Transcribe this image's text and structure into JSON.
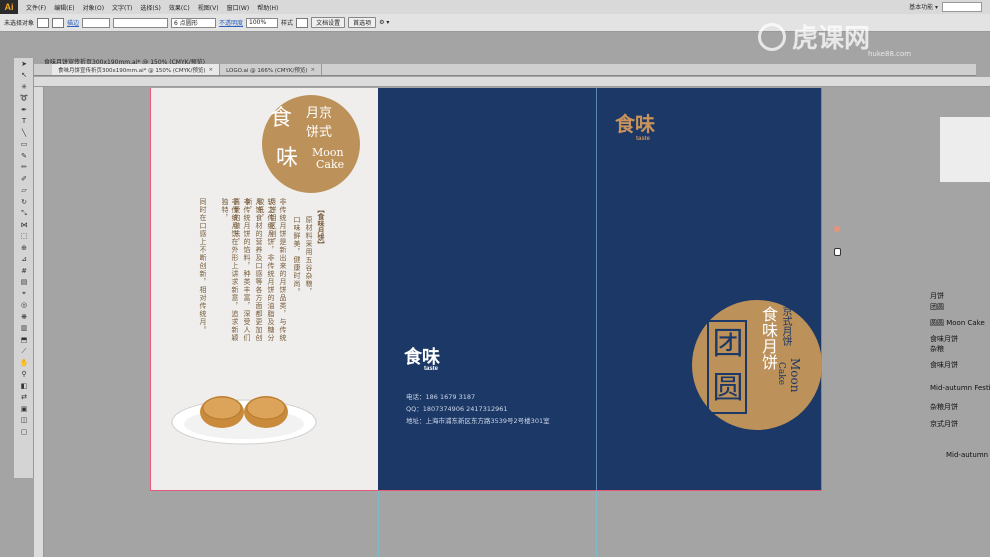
{
  "app": {
    "logo": "Ai",
    "menu": [
      "文件(F)",
      "编辑(E)",
      "对象(O)",
      "文字(T)",
      "选择(S)",
      "效果(C)",
      "视图(V)",
      "窗口(W)",
      "帮助(H)"
    ],
    "workspace": "基本功能 ▾"
  },
  "control_bar": {
    "selection": "未选择对象",
    "stroke_label": "描边",
    "stroke_width": "6 点圆形",
    "opacity_label": "不透明度",
    "opacity_value": "100%",
    "style_label": "样式",
    "doc_setup": "文档设置",
    "prefs": "首选项"
  },
  "document": {
    "title": "食味月饼宣传折页300x190mm.ai* @ 150% (CMYK/预览)",
    "tabs": [
      {
        "label": "食味月饼宣传折页300x190mm.ai* @ 150% (CMYK/预览)",
        "active": true
      },
      {
        "label": "LOGO.ai @ 166% (CMYK/预览)",
        "active": false
      }
    ]
  },
  "artwork": {
    "cover_circle": {
      "big1": "食",
      "big2": "味",
      "small1": "月京",
      "small2": "饼式",
      "en1": "Moon",
      "en2": "Cake"
    },
    "product_title": "【食味月饼】",
    "product_copy": [
      "原材料采用五谷杂粮，",
      "口味鲜美，健康时尚。",
      "非传统月饼是新出来的月饼品类，与传统月饼相区别，",
      "较之传统月饼，非传统月饼的油脂及糖分较低，",
      "月饼食材的营养及口感等各方面都更加创新，",
      "非传统月饼的馅料，种类丰富，深受人们喜爱的做法，",
      "非传统月饼在外形上讲求新意，追求新颖独特，",
      "同时在口感上不断创新，相对传统月。"
    ],
    "logo": {
      "cn": "食味",
      "en": "taste"
    },
    "contact": {
      "phone": "电话：186 1679 3187",
      "qq": "QQ：1807374906  2417312961",
      "address": "地址：上海市浦东新区东方路3539号2号楼301室"
    },
    "back_circle": {
      "tuan": "团",
      "yuan": "圆",
      "line1": "食味月饼",
      "line2": "京式月饼",
      "en1": "Moon",
      "en2": "Cake"
    }
  },
  "layers_panel": [
    "月饼",
    "团圆",
    "圆圆 Moon Cake",
    "食味月饼",
    "杂粮",
    "食味月饼",
    "Mid-autumn Festiv",
    "杂粮月饼",
    "京式月饼",
    "Mid-autumn F"
  ],
  "watermark": {
    "brand": "虎课网",
    "domain": "huke88.com"
  }
}
